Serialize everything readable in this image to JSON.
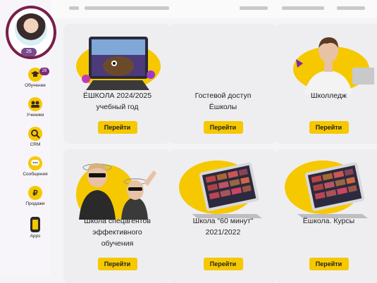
{
  "sidebar": {
    "avatar_badge": "26",
    "items": [
      {
        "icon": "graduation-cap-icon",
        "label": "Обучение",
        "badge": "29"
      },
      {
        "icon": "students-icon",
        "label": "Ученики"
      },
      {
        "icon": "magnifier-icon",
        "label": "CRM"
      },
      {
        "icon": "chat-bubble-icon",
        "label": "Сообщения"
      },
      {
        "icon": "ruble-icon",
        "label": "Продажи",
        "glyph": "₽"
      },
      {
        "icon": "phone-icon",
        "label": "Apps"
      }
    ]
  },
  "cards": [
    {
      "title_line1": "ЁШКОЛА 2024/2025",
      "title_line2": "учебный год",
      "title_line3": "",
      "button": "Перейти"
    },
    {
      "title_line1": "Гостевой доступ",
      "title_line2": "Ёшколы",
      "title_line3": "",
      "button": "Перейти"
    },
    {
      "title_line1": "Школледж",
      "title_line2": "",
      "title_line3": "",
      "button": "Перейти"
    },
    {
      "title_line1": "Школа спецагентов",
      "title_line2": "эффективного",
      "title_line3": "обучения",
      "button": "Перейти"
    },
    {
      "title_line1": "Школа \"60 минут\"",
      "title_line2": "2021/2022",
      "title_line3": "",
      "button": "Перейти"
    },
    {
      "title_line1": "Ёшкола. Курсы",
      "title_line2": "",
      "title_line3": "",
      "button": "Перейти"
    }
  ]
}
